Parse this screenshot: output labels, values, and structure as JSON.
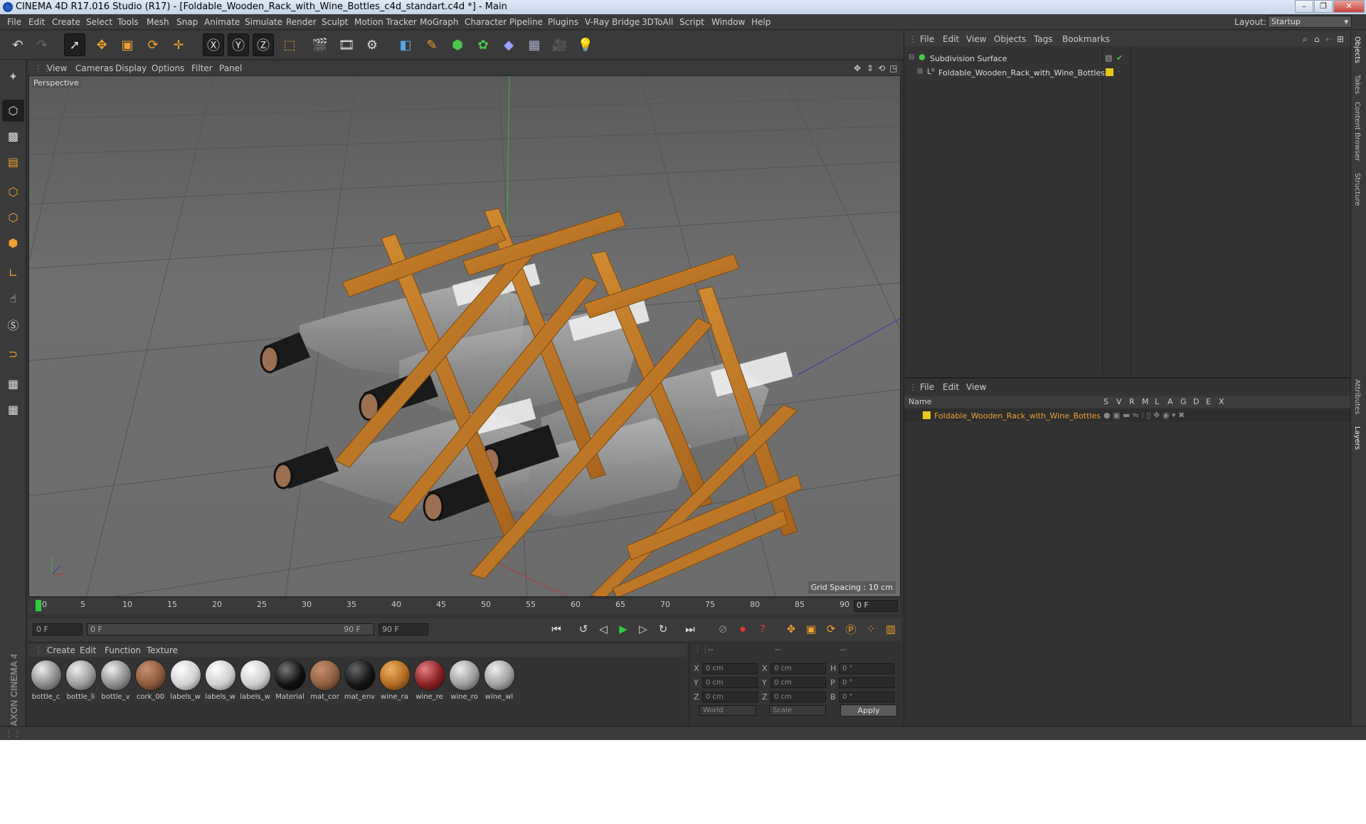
{
  "window": {
    "title": "CINEMA 4D R17.016 Studio (R17) - [Foldable_Wooden_Rack_with_Wine_Bottles_c4d_standart.c4d *] - Main",
    "controls": [
      "–",
      "❐",
      "✕"
    ]
  },
  "menubar": {
    "items": [
      "File",
      "Edit",
      "Create",
      "Select",
      "Tools",
      "Mesh",
      "Snap",
      "Animate",
      "Simulate",
      "Render",
      "Sculpt",
      "Motion Tracker",
      "MoGraph",
      "Character",
      "Pipeline",
      "Plugins",
      "V-Ray Bridge",
      "3DToAll",
      "Script",
      "Window",
      "Help"
    ],
    "layout_label": "Layout:",
    "layout_value": "Startup"
  },
  "viewport": {
    "menu": [
      "View",
      "Cameras",
      "Display",
      "Options",
      "Filter",
      "Panel"
    ],
    "label": "Perspective",
    "grid_spacing": "Grid Spacing : 10 cm"
  },
  "timeline": {
    "ticks": [
      "0",
      "5",
      "10",
      "15",
      "20",
      "25",
      "30",
      "35",
      "40",
      "45",
      "50",
      "55",
      "60",
      "65",
      "70",
      "75",
      "80",
      "85",
      "90"
    ],
    "current_frame": "0 F",
    "start_field": "0 F",
    "range_start": "0 F",
    "range_end": "90 F",
    "end_field": "90 F"
  },
  "materials": {
    "menu": [
      "Create",
      "Edit",
      "Function",
      "Texture"
    ],
    "items": [
      {
        "name": "bottle_c",
        "color": "#8a8a8a"
      },
      {
        "name": "bottle_li",
        "color": "#9a9a9a"
      },
      {
        "name": "bottle_v",
        "color": "#8c8c8c"
      },
      {
        "name": "cork_00",
        "color": "#8a5a3a"
      },
      {
        "name": "labels_w",
        "color": "#d0d0d0"
      },
      {
        "name": "labels_w",
        "color": "#cfcfcf"
      },
      {
        "name": "labels_w",
        "color": "#cccccc"
      },
      {
        "name": "Material",
        "color": "#111111"
      },
      {
        "name": "mat_cor",
        "color": "#8b5e40"
      },
      {
        "name": "mat_env",
        "color": "#151515"
      },
      {
        "name": "wine_ra",
        "color": "#b06a20"
      },
      {
        "name": "wine_re",
        "color": "#8a2020"
      },
      {
        "name": "wine_ro",
        "color": "#9a9a9a"
      },
      {
        "name": "wine_wl",
        "color": "#a0a0a0"
      }
    ]
  },
  "coordinates": {
    "headers": [
      "--",
      "--",
      "--"
    ],
    "rows": [
      {
        "a": "X",
        "av": "0 cm",
        "b": "X",
        "bv": "0 cm",
        "c": "H",
        "cv": "0 °"
      },
      {
        "a": "Y",
        "av": "0 cm",
        "b": "Y",
        "bv": "0 cm",
        "c": "P",
        "cv": "0 °"
      },
      {
        "a": "Z",
        "av": "0 cm",
        "b": "Z",
        "bv": "0 cm",
        "c": "B",
        "cv": "0 °"
      }
    ],
    "mode": "World",
    "scale": "Scale",
    "apply": "Apply"
  },
  "objects": {
    "menu": [
      "File",
      "Edit",
      "View",
      "Objects",
      "Tags",
      "Bookmarks"
    ],
    "items": [
      "Subdivision Surface",
      "Foldable_Wooden_Rack_with_Wine_Bottles"
    ]
  },
  "layers": {
    "menu": [
      "File",
      "Edit",
      "View"
    ],
    "header_name": "Name",
    "columns": [
      "S",
      "V",
      "R",
      "M",
      "L",
      "A",
      "G",
      "D",
      "E",
      "X"
    ],
    "items": [
      "Foldable_Wooden_Rack_with_Wine_Bottles"
    ]
  },
  "side_tabs": [
    "Objects",
    "Takes",
    "Content Browser",
    "Structure",
    "Attributes",
    "Layers"
  ],
  "branding": "MAXON CINEMA 4D",
  "colors": {
    "accent": "#f0a030",
    "layer_yellow": "#e8c81a",
    "bg": "#333333"
  }
}
